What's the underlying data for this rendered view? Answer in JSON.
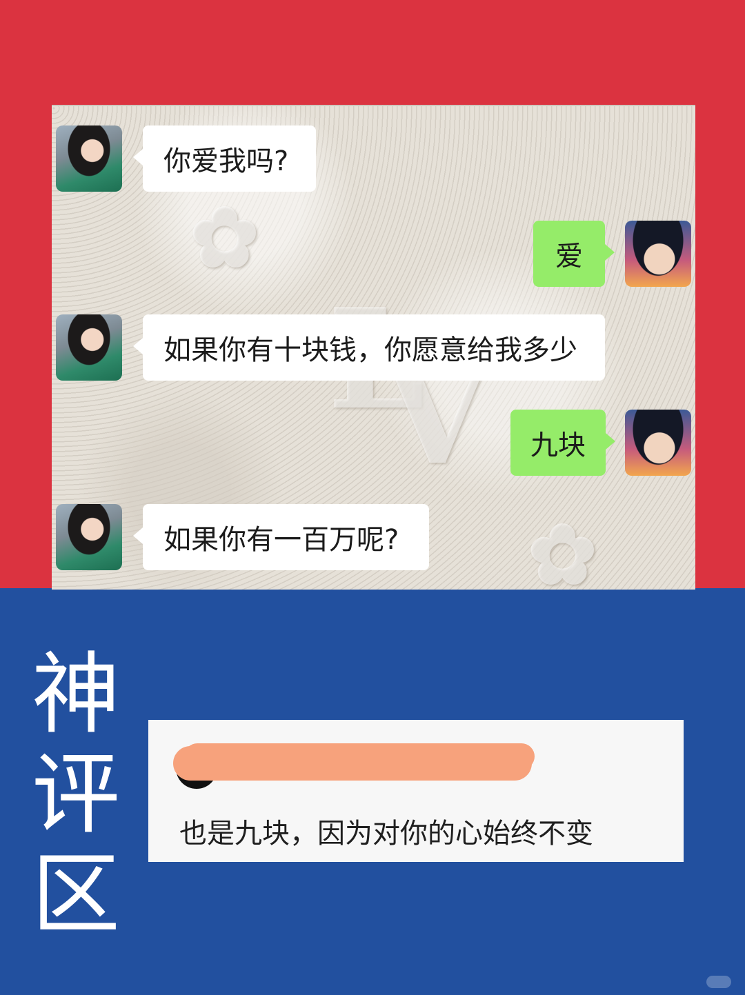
{
  "colors": {
    "top_background": "#db3340",
    "bottom_background": "#22509f",
    "outgoing_bubble": "#95ec69",
    "incoming_bubble": "#ffffff",
    "comment_redaction": "#f7a27c"
  },
  "chat": {
    "messages": [
      {
        "sender": "other",
        "avatar": "girl-avatar",
        "text": "你爱我吗?"
      },
      {
        "sender": "self",
        "avatar": "boy-avatar",
        "text": "爱"
      },
      {
        "sender": "other",
        "avatar": "girl-avatar",
        "text": "如果你有十块钱，你愿意给我多少"
      },
      {
        "sender": "self",
        "avatar": "boy-avatar",
        "text": "九块"
      },
      {
        "sender": "other",
        "avatar": "girl-avatar",
        "text": "如果你有一百万呢?"
      }
    ]
  },
  "side_title": {
    "chars": [
      "神",
      "评",
      "区"
    ]
  },
  "comment": {
    "text": "也是九块，因为对你的心始终不变"
  }
}
